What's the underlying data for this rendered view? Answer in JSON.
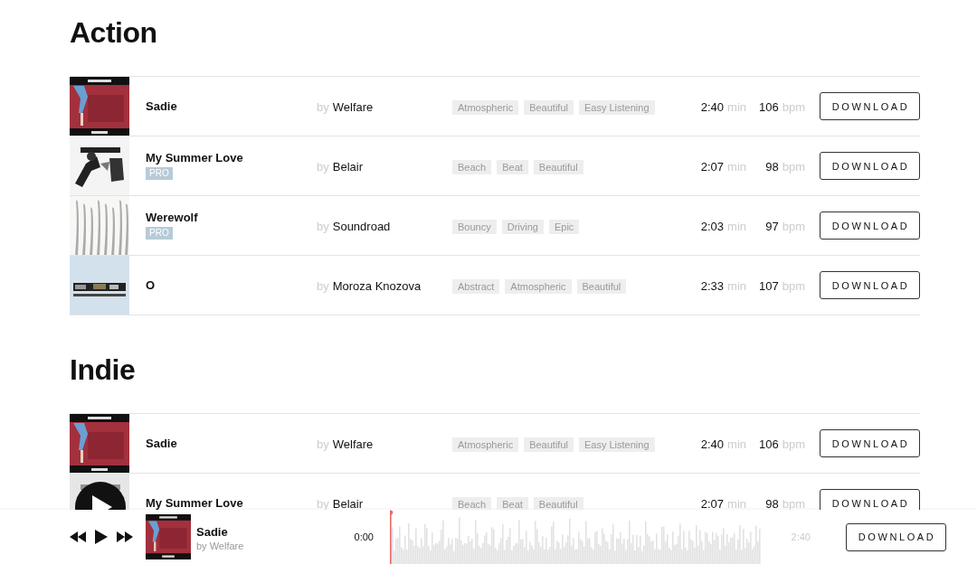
{
  "sections": [
    {
      "title": "Action",
      "tracks": [
        {
          "title": "Sadie",
          "pro": false,
          "show_play": false,
          "by": "by",
          "artist": "Welfare",
          "tags": [
            "Atmospheric",
            "Beautiful",
            "Easy Listening"
          ],
          "duration": "2:40",
          "duration_unit": "min",
          "bpm": "106",
          "bpm_unit": "bpm",
          "button": "DOWNLOAD"
        },
        {
          "title": "My Summer Love",
          "pro": true,
          "pro_label": "PRO",
          "show_play": false,
          "by": "by",
          "artist": "Belair",
          "tags": [
            "Beach",
            "Beat",
            "Beautiful"
          ],
          "duration": "2:07",
          "duration_unit": "min",
          "bpm": "98",
          "bpm_unit": "bpm",
          "button": "DOWNLOAD"
        },
        {
          "title": "Werewolf",
          "pro": true,
          "pro_label": "PRO",
          "show_play": false,
          "by": "by",
          "artist": "Soundroad",
          "tags": [
            "Bouncy",
            "Driving",
            "Epic"
          ],
          "duration": "2:03",
          "duration_unit": "min",
          "bpm": "97",
          "bpm_unit": "bpm",
          "button": "DOWNLOAD"
        },
        {
          "title": "O",
          "pro": false,
          "show_play": false,
          "by": "by",
          "artist": "Moroza Knozova",
          "tags": [
            "Abstract",
            "Atmospheric",
            "Beautiful"
          ],
          "duration": "2:33",
          "duration_unit": "min",
          "bpm": "107",
          "bpm_unit": "bpm",
          "button": "DOWNLOAD"
        }
      ]
    },
    {
      "title": "Indie",
      "tracks": [
        {
          "title": "Sadie",
          "pro": false,
          "show_play": false,
          "by": "by",
          "artist": "Welfare",
          "tags": [
            "Atmospheric",
            "Beautiful",
            "Easy Listening"
          ],
          "duration": "2:40",
          "duration_unit": "min",
          "bpm": "106",
          "bpm_unit": "bpm",
          "button": "DOWNLOAD"
        },
        {
          "title": "My Summer Love",
          "pro": false,
          "show_play": true,
          "by": "by",
          "artist": "Belair",
          "tags": [
            "Beach",
            "Beat",
            "Beautiful"
          ],
          "duration": "2:07",
          "duration_unit": "min",
          "bpm": "98",
          "bpm_unit": "bpm",
          "button": "DOWNLOAD"
        }
      ]
    }
  ],
  "player": {
    "title": "Sadie",
    "artist": "by Welfare",
    "elapsed": "0:00",
    "total": "2:40",
    "level": 0,
    "button": "DOWNLOAD"
  }
}
